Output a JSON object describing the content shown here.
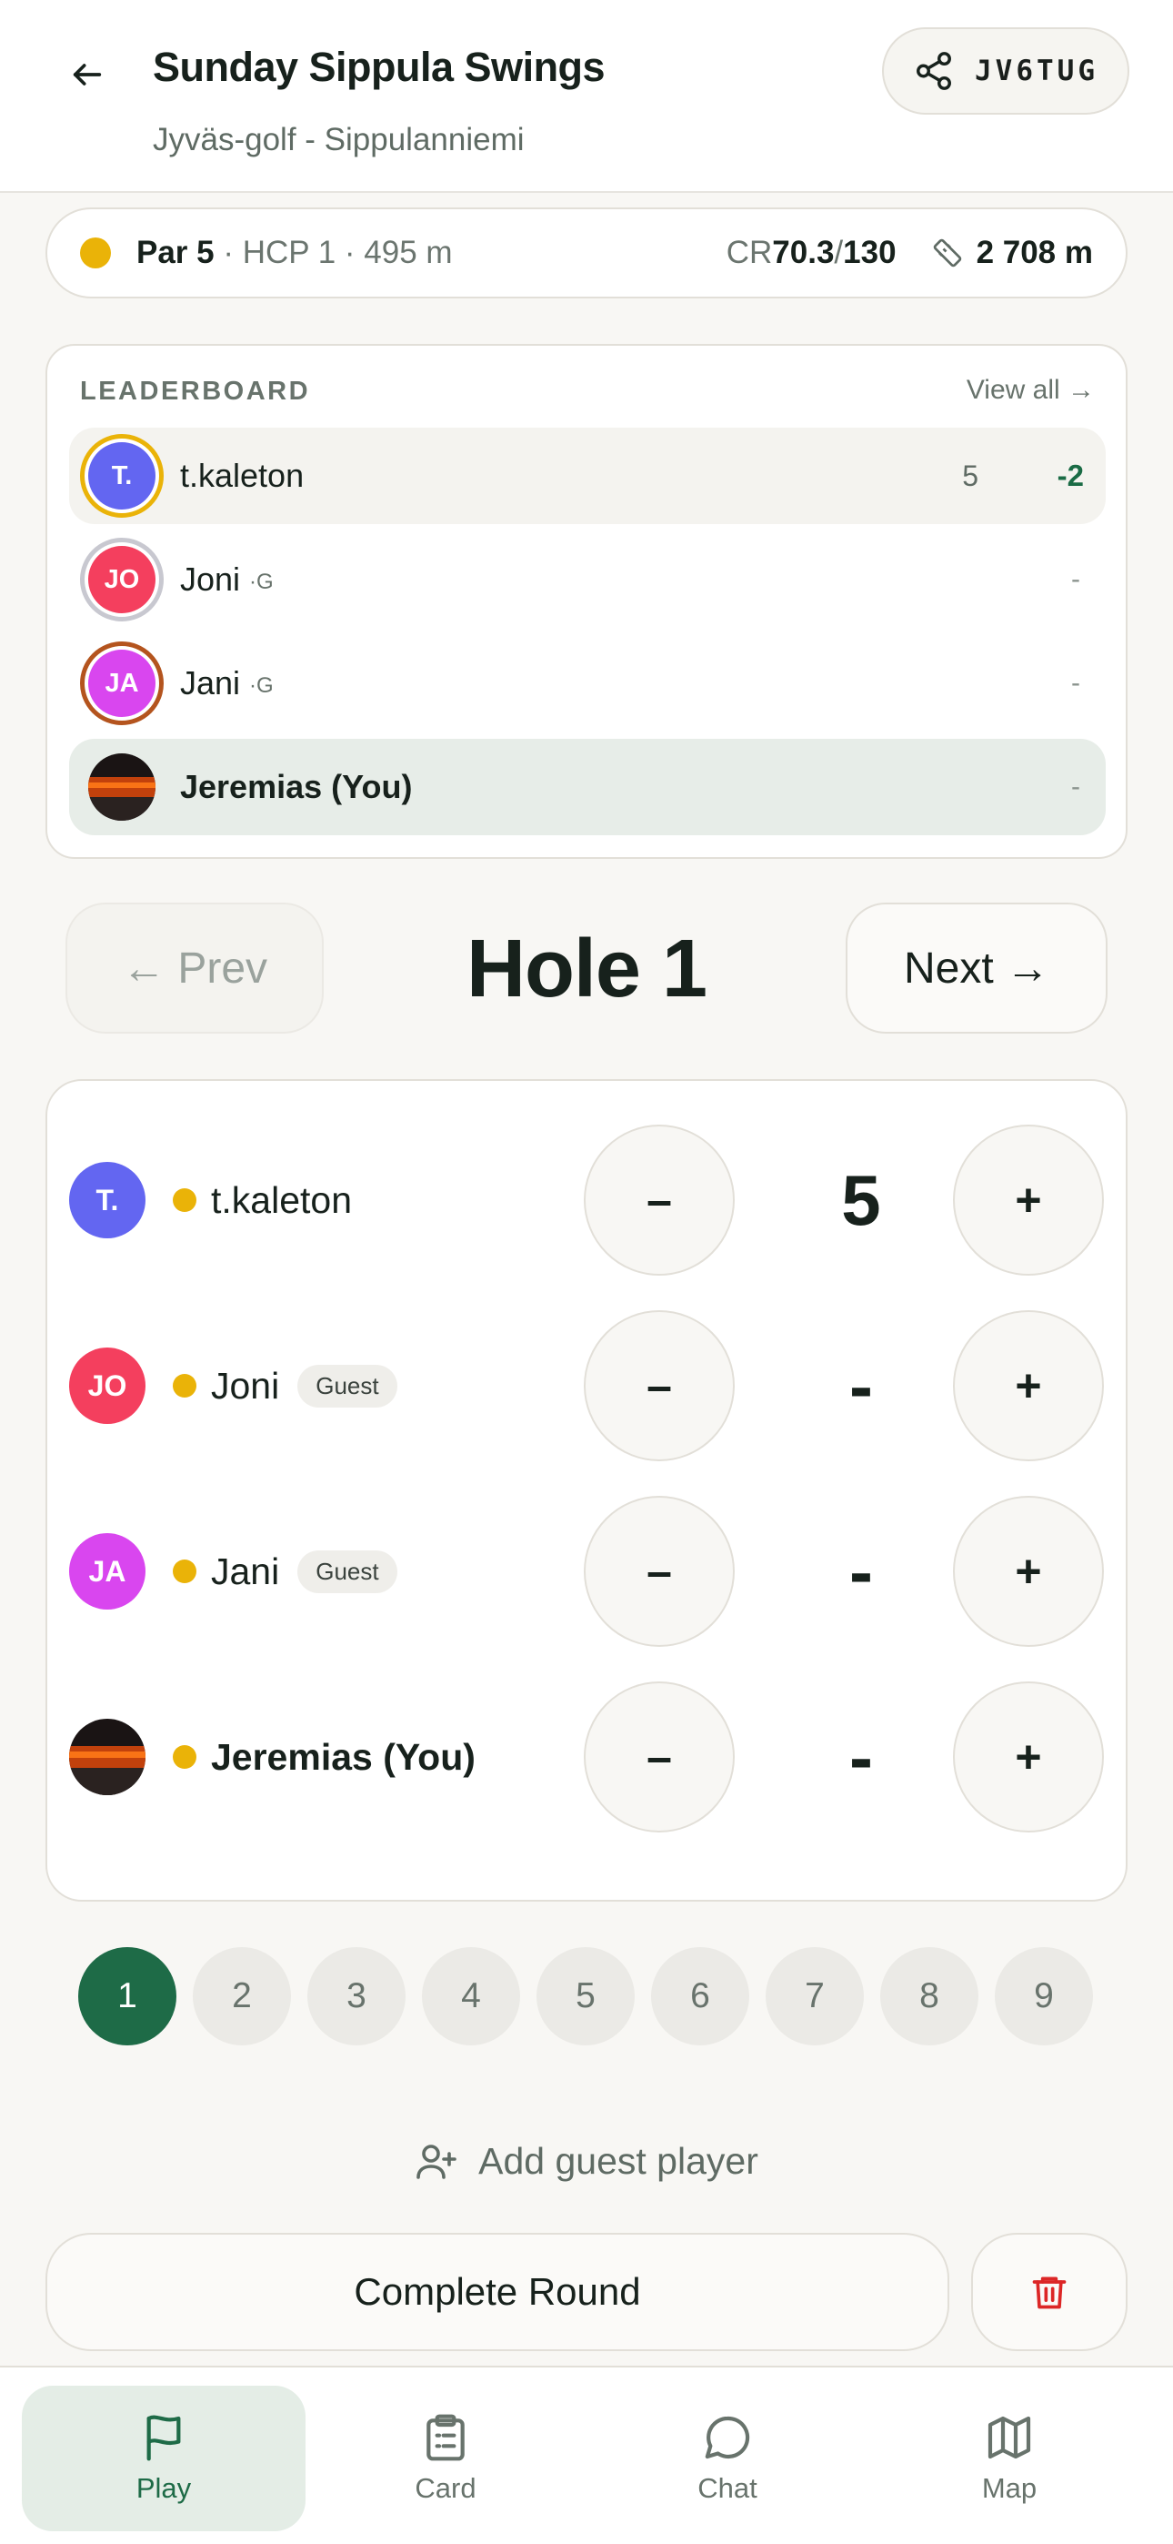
{
  "header": {
    "title": "Sunday Sippula Swings",
    "subtitle": "Jyväs-golf - Sippulanniemi",
    "share_code": "JV6TUG"
  },
  "course": {
    "par": "Par 5",
    "details": " · HCP 1 · 495 m",
    "cr_label": "CR ",
    "cr_value": "70.3",
    "slope_sep": " / ",
    "slope": "130",
    "length": "2 708 m",
    "tee_color": "#eab308"
  },
  "leaderboard": {
    "title": "LEADERBOARD",
    "view_all": "View all →",
    "rows": [
      {
        "initials": "T.",
        "name": "t.kaleton",
        "thru": "5",
        "score": "-2",
        "avatar_color": "#6366f1",
        "ring_color": "#eab308"
      },
      {
        "initials": "JO",
        "name": "Joni",
        "tag": "·G",
        "score": "-",
        "avatar_color": "#f43f5e",
        "ring_color": "#c8c8d0"
      },
      {
        "initials": "JA",
        "name": "Jani",
        "tag": "·G",
        "score": "-",
        "avatar_color": "#d946ef",
        "ring_color": "#b4541e"
      },
      {
        "name": "Jeremias (You)",
        "score": "-"
      }
    ]
  },
  "hole_nav": {
    "prev": "← Prev",
    "hole": "Hole 1",
    "next": "Next →"
  },
  "players": [
    {
      "initials": "T.",
      "name": "t.kaleton",
      "score": "5",
      "avatar_color": "#6366f1"
    },
    {
      "initials": "JO",
      "name": "Joni",
      "badge": "Guest",
      "score": "-",
      "avatar_color": "#f43f5e"
    },
    {
      "initials": "JA",
      "name": "Jani",
      "badge": "Guest",
      "score": "-",
      "avatar_color": "#d946ef"
    },
    {
      "name": "Jeremias (You)",
      "score": "-"
    }
  ],
  "controls": {
    "minus": "–",
    "plus": "+"
  },
  "holes": [
    "1",
    "2",
    "3",
    "4",
    "5",
    "6",
    "7",
    "8",
    "9"
  ],
  "actions": {
    "add_guest": "Add guest player",
    "complete": "Complete Round"
  },
  "tabs": {
    "play": "Play",
    "card": "Card",
    "chat": "Chat",
    "map": "Map"
  },
  "colors": {
    "accent": "#1e6b47",
    "danger": "#dc2626"
  }
}
